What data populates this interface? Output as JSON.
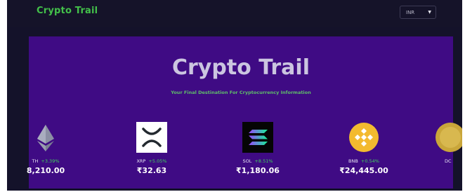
{
  "header": {
    "brand": "Crypto Trail",
    "currency_select": {
      "selected": "INR"
    }
  },
  "hero": {
    "title": "Crypto Trail",
    "subtitle": "Your Final Destination For Cryptocurrency Information"
  },
  "coins": [
    {
      "symbol": "TH",
      "change": "+3.39%",
      "price": "8,210.00",
      "icon": "ethereum-icon"
    },
    {
      "symbol": "XRP",
      "change": "+5.05%",
      "price": "₹32.63",
      "icon": "xrp-icon"
    },
    {
      "symbol": "SOL",
      "change": "+8.51%",
      "price": "₹1,180.06",
      "icon": "solana-icon"
    },
    {
      "symbol": "BNB",
      "change": "+0.54%",
      "price": "₹24,445.00",
      "icon": "bnb-icon"
    },
    {
      "symbol": "DC",
      "change": "",
      "price": "",
      "icon": "dogecoin-icon"
    }
  ],
  "colors": {
    "brand_green": "#43c04a",
    "hero_bg": "#3f0b84",
    "positive_change": "#3fd35a"
  }
}
